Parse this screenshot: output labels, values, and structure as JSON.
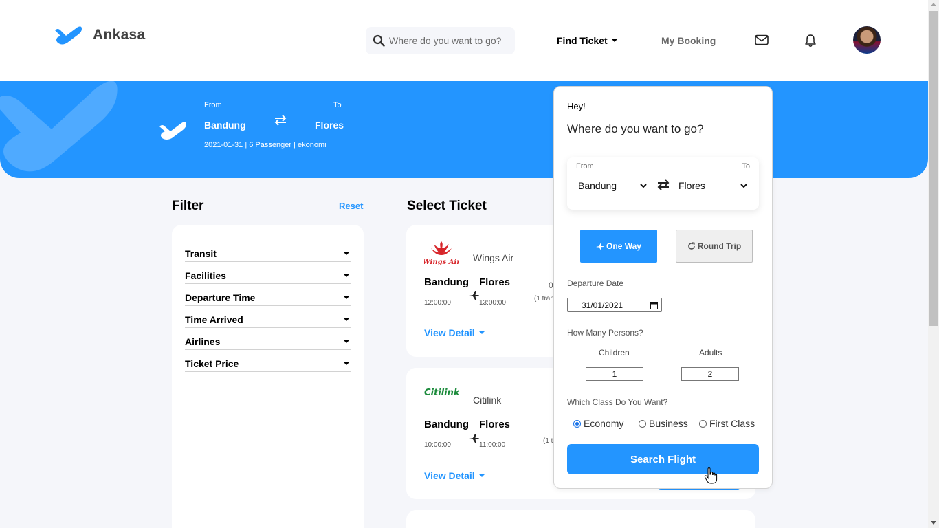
{
  "header": {
    "brand": "Ankasa",
    "search_placeholder": "Where do you want to go?",
    "nav_find_ticket": "Find Ticket",
    "nav_my_booking": "My Booking"
  },
  "banner": {
    "from_label": "From",
    "to_label": "To",
    "from_city": "Bandung",
    "to_city": "Flores",
    "meta": "2021-01-31 | 6 Passenger | ekonomi"
  },
  "filter": {
    "title": "Filter",
    "reset": "Reset",
    "items": [
      "Transit",
      "Facilities",
      "Departure Time",
      "Time Arrived",
      "Airlines",
      "Ticket Price"
    ]
  },
  "tickets": {
    "title": "Select Ticket",
    "list": [
      {
        "airline": "Wings Air",
        "logo_text": "Wings Air",
        "from": "Bandung",
        "to": "Flores",
        "depart": "12:00:00",
        "arrive": "13:00:00",
        "duration": "0",
        "transit": "(1 tran",
        "detail": "View Detail"
      },
      {
        "airline": "Citilink",
        "logo_text": "Citilink",
        "from": "Bandung",
        "to": "Flores",
        "depart": "10:00:00",
        "arrive": "11:00:00",
        "duration": "",
        "transit": "(1 t",
        "detail": "View Detail"
      }
    ]
  },
  "popup": {
    "hey": "Hey!",
    "title": "Where do you want to go?",
    "from_label": "From",
    "to_label": "To",
    "from_value": "Bandung",
    "to_value": "Flores",
    "one_way": "One Way",
    "round_trip": "Round Trip",
    "departure_label": "Departure Date",
    "departure_value": "31/01/2021",
    "persons_label": "How Many Persons?",
    "children_label": "Children",
    "children_value": "1",
    "adults_label": "Adults",
    "adults_value": "2",
    "class_label": "Which Class Do You Want?",
    "classes": [
      "Economy",
      "Business",
      "First Class"
    ],
    "selected_class": "Economy",
    "search_button": "Search Flight"
  },
  "colors": {
    "primary": "#2395ff",
    "background": "#f5f6fa",
    "wings_red": "#d7262b",
    "citilink_green": "#1a8a3a"
  },
  "icons": [
    "plane-logo-icon",
    "search-icon",
    "mail-icon",
    "bell-icon",
    "swap-icon",
    "plane-icon",
    "chevron-down-icon",
    "calendar-icon",
    "redo-icon",
    "cursor-hand-icon"
  ]
}
